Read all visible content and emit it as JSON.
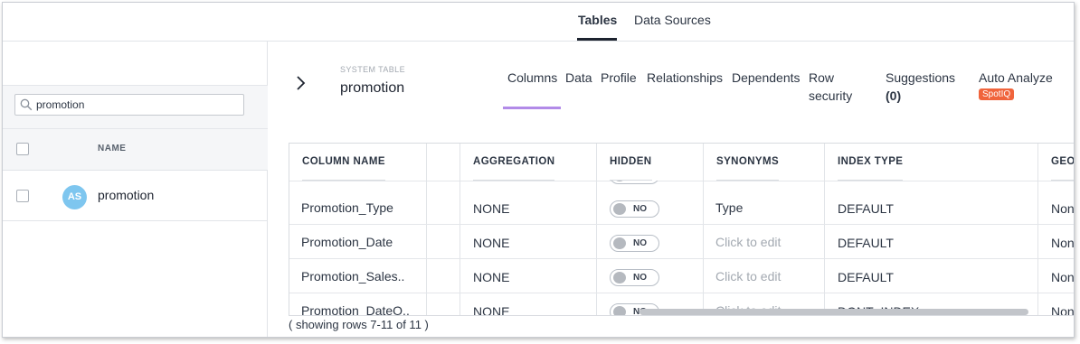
{
  "topnav": {
    "tabs": [
      "Tables",
      "Data Sources"
    ],
    "active": "Tables"
  },
  "left": {
    "search": {
      "value": "promotion",
      "icon": "search-icon"
    },
    "header": {
      "name_label": "NAME"
    },
    "rows": [
      {
        "initials": "AS",
        "name": "promotion"
      }
    ]
  },
  "detail": {
    "kind_label": "SYSTEM TABLE",
    "table_name": "promotion",
    "tabs": {
      "columns": "Columns",
      "data": "Data",
      "profile": "Profile",
      "relationships": "Relationships",
      "dependents": "Dependents",
      "row_security_1": "Row",
      "row_security_2": "security",
      "suggestions": "Suggestions",
      "suggestions_count": "(0)",
      "auto_analyze": "Auto Analyze",
      "spotiq_badge": "SpotIQ"
    },
    "active_tab": "Columns"
  },
  "table": {
    "headers": [
      "COLUMN NAME",
      "AGGREGATION",
      "HIDDEN",
      "SYNONYMS",
      "INDEX TYPE",
      "GEO"
    ],
    "rows": [
      {
        "name": "Promotion_Type",
        "aggregation": "NONE",
        "hidden": "NO",
        "synonyms": "Type",
        "index_type": "DEFAULT",
        "geo": "None"
      },
      {
        "name": "Promotion_Date",
        "aggregation": "NONE",
        "hidden": "NO",
        "synonyms": "Click to edit",
        "index_type": "DEFAULT",
        "geo": "None"
      },
      {
        "name": "Promotion_Sales..",
        "aggregation": "NONE",
        "hidden": "NO",
        "synonyms": "Click to edit",
        "index_type": "DEFAULT",
        "geo": "None"
      },
      {
        "name": "Promotion_DateO..",
        "aggregation": "NONE",
        "hidden": "NO",
        "synonyms": "Click to edit",
        "index_type": "DONT_INDEX",
        "geo": "None"
      }
    ],
    "status": "( showing rows 7-11 of 11 )"
  },
  "colors": {
    "accent_tab": "#b28be8",
    "spotiq": "#f0643c",
    "avatar": "#7ec6ef"
  }
}
